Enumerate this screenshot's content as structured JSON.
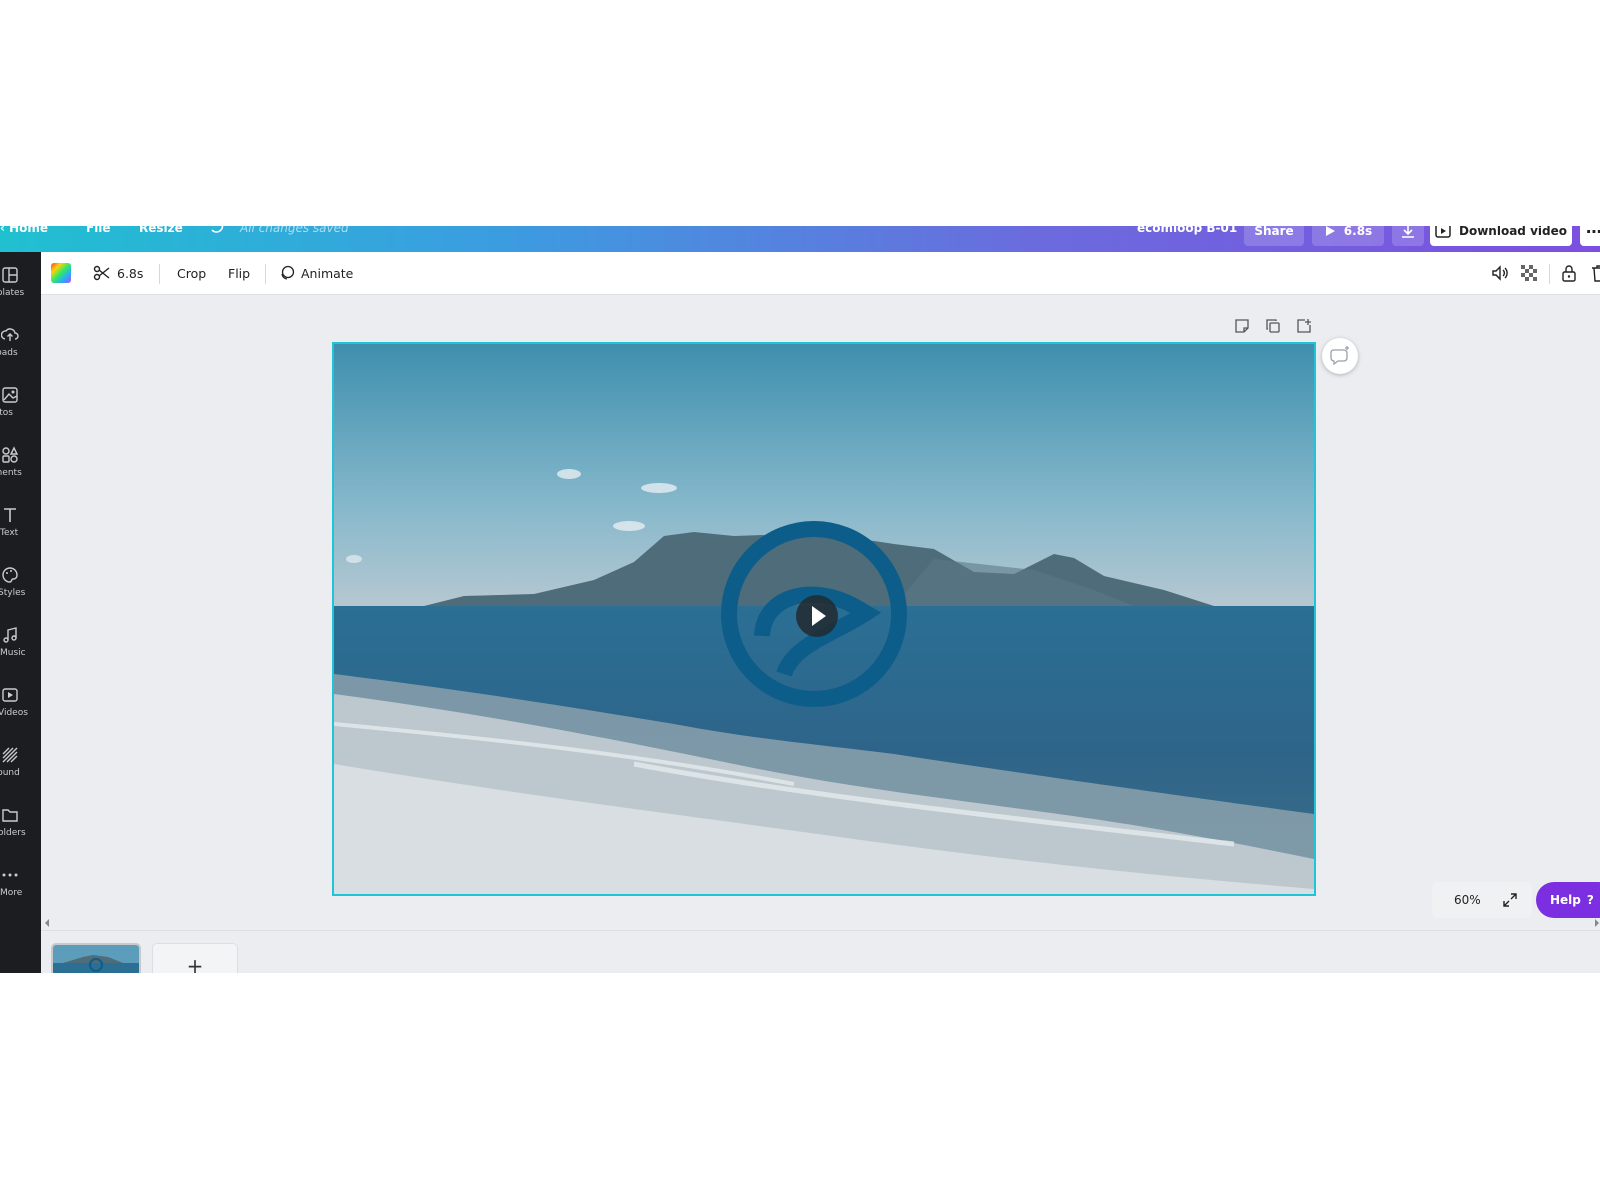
{
  "topbar": {
    "home": "Home",
    "file": "File",
    "resize": "Resize",
    "status": "All changes saved",
    "doc_title": "ecomloop B-01",
    "share": "Share",
    "play_duration": "6.8s",
    "download_video": "Download video"
  },
  "sidebar": {
    "items": [
      {
        "label": "mplates",
        "icon": "templates-icon"
      },
      {
        "label": "ploads",
        "icon": "uploads-icon"
      },
      {
        "label": "hotos",
        "icon": "photos-icon"
      },
      {
        "label": "ements",
        "icon": "elements-icon"
      },
      {
        "label": "Text",
        "icon": "text-icon"
      },
      {
        "label": "Styles",
        "icon": "styles-icon"
      },
      {
        "label": "Music",
        "icon": "music-icon"
      },
      {
        "label": "Videos",
        "icon": "videos-icon"
      },
      {
        "label": "ground",
        "icon": "background-icon"
      },
      {
        "label": "olders",
        "icon": "folders-icon"
      },
      {
        "label": "More",
        "icon": "more-icon"
      }
    ]
  },
  "toolbar": {
    "duration": "6.8s",
    "crop": "Crop",
    "flip": "Flip",
    "animate": "Animate"
  },
  "canvas": {
    "accent_color": "#1fc4d6"
  },
  "bottom": {
    "zoom": "60%",
    "help": "Help",
    "help_icon": "?",
    "add_page": "+"
  },
  "colors": {
    "brand_purple": "#7b2fe0",
    "sidebar_bg": "#1b1d21"
  }
}
